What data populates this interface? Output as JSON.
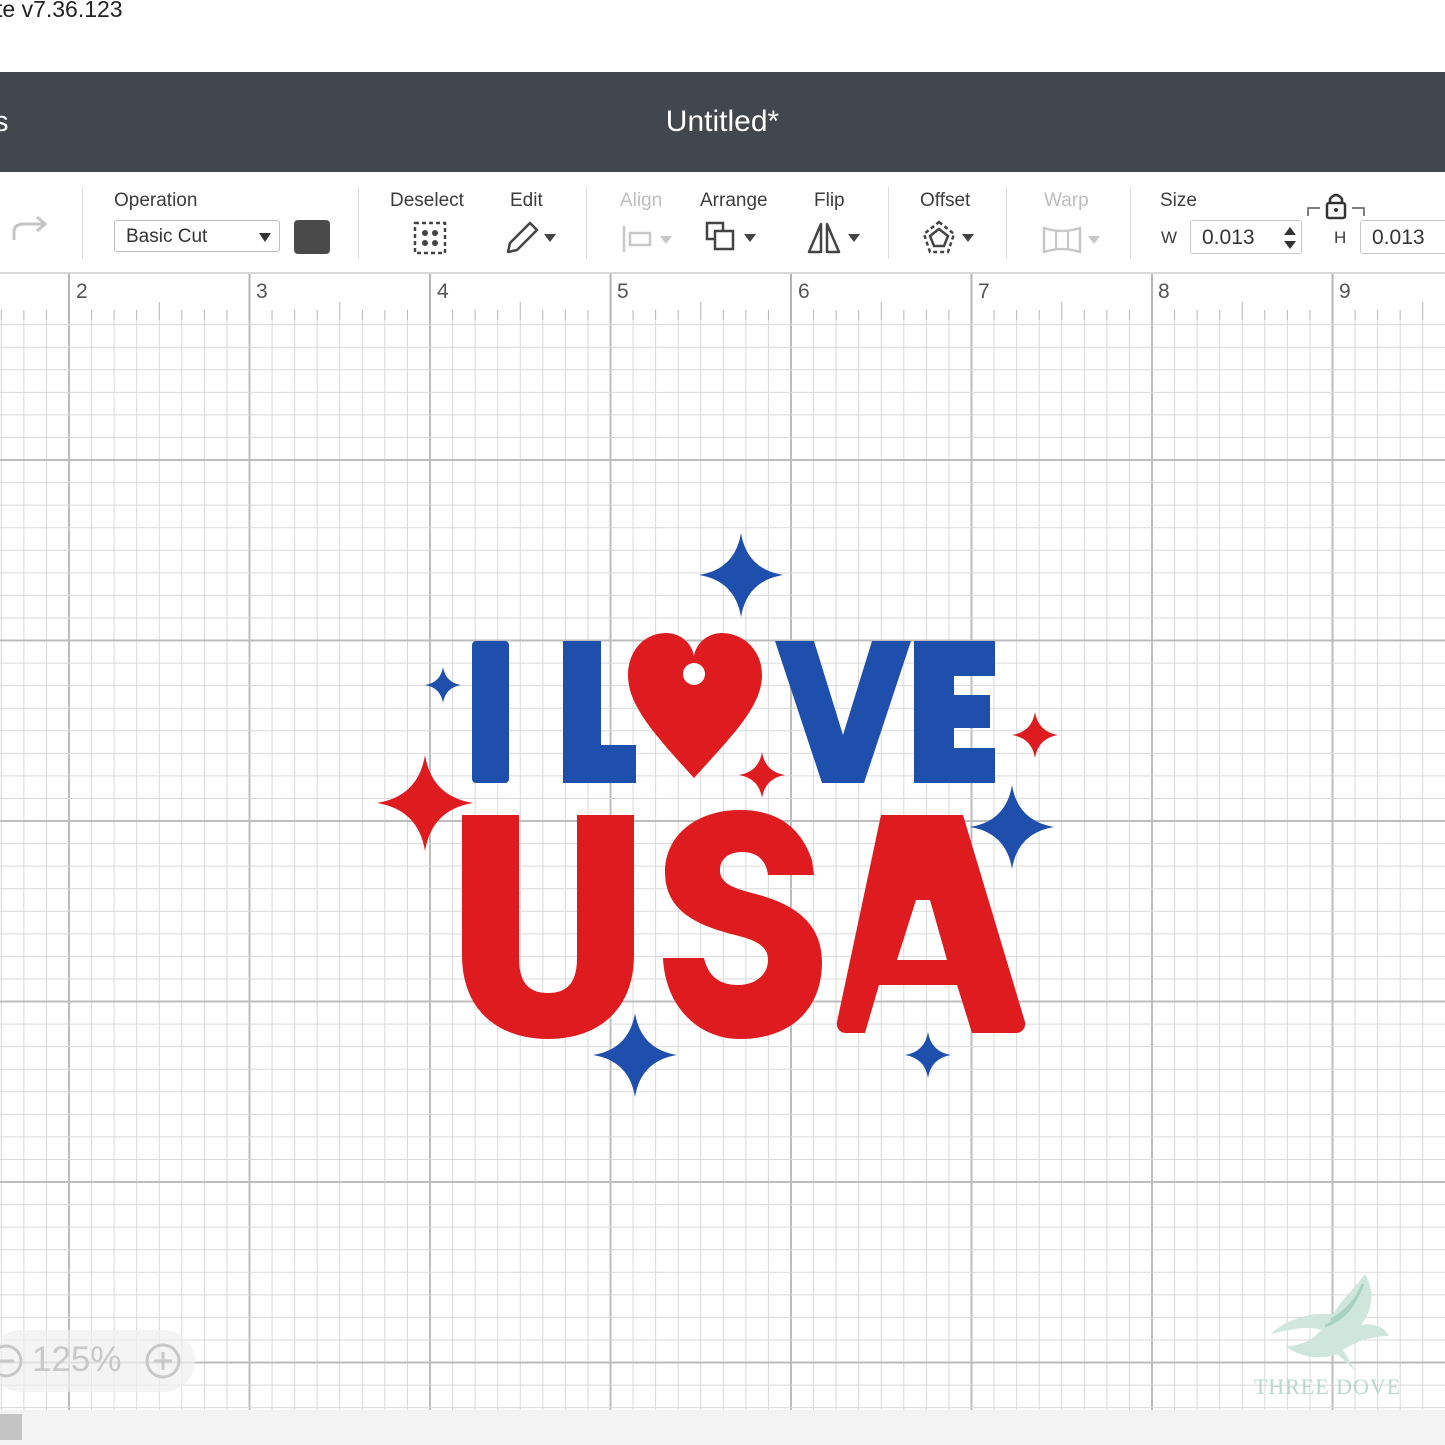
{
  "app": {
    "version_text": "te  v7.36.123",
    "header_left": "s",
    "document_title": "Untitled*"
  },
  "toolbar": {
    "operation_label": "Operation",
    "operation_value": "Basic Cut",
    "deselect_label": "Deselect",
    "edit_label": "Edit",
    "align_label": "Align",
    "arrange_label": "Arrange",
    "flip_label": "Flip",
    "offset_label": "Offset",
    "warp_label": "Warp",
    "size_label": "Size",
    "w_label": "W",
    "w_value": "0.013",
    "h_label": "H",
    "h_value": "0.013"
  },
  "ruler": {
    "marks": [
      "2",
      "3",
      "4",
      "5",
      "6",
      "7",
      "8",
      "9"
    ]
  },
  "design": {
    "line1": "I LOVE",
    "line2": "USA",
    "blue": "#1e4fac",
    "red": "#de1b1e"
  },
  "zoom": {
    "value": "125%"
  },
  "watermark": {
    "text": "THREE DOVE"
  },
  "colors": {
    "header_bg": "#42464d",
    "swatch": "#4a4a4a",
    "grid_minor": "#d9d9d9",
    "grid_major": "#bdbdbd"
  }
}
